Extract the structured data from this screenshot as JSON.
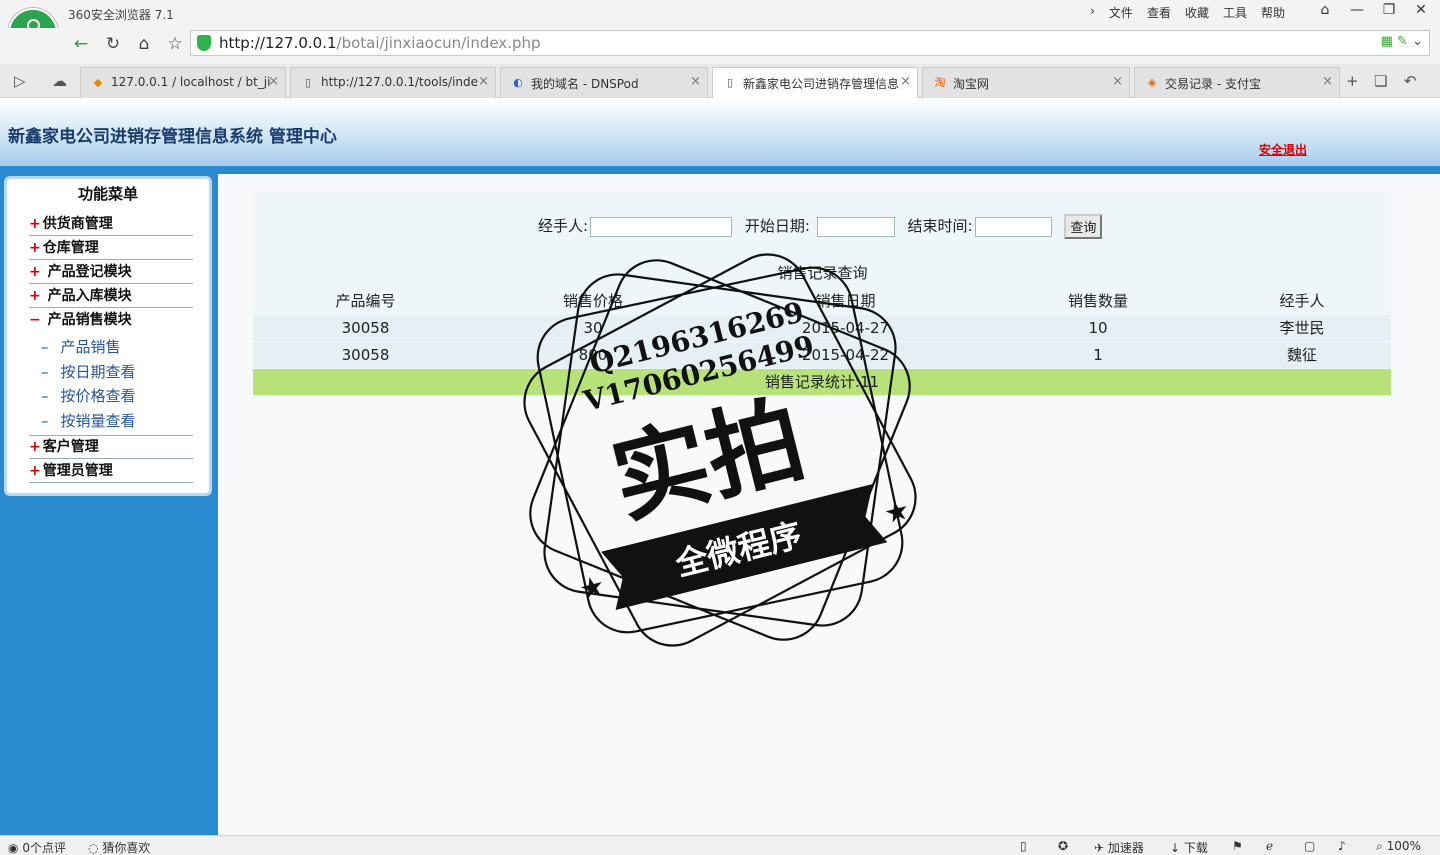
{
  "browser": {
    "app_title": "360安全浏览器 7.1",
    "menu": [
      "文件",
      "查看",
      "收藏",
      "工具",
      "帮助"
    ],
    "url_host": "http://127.0.0.1",
    "url_path": "/botai/jinxiaocun/index.php",
    "tabs": [
      {
        "label": "127.0.0.1 / localhost / bt_ji",
        "active": false
      },
      {
        "label": "http://127.0.0.1/tools/inde",
        "active": false
      },
      {
        "label": "我的域名 - DNSPod",
        "active": false
      },
      {
        "label": "新鑫家电公司进销存管理信息",
        "active": true
      },
      {
        "label": "淘宝网",
        "active": false
      },
      {
        "label": "交易记录 - 支付宝",
        "active": false
      }
    ],
    "zoom": "100%"
  },
  "header": {
    "title": "新鑫家电公司进销存管理信息系统 管理中心",
    "logout": "安全退出"
  },
  "sidebar": {
    "title": "功能菜单",
    "items": [
      {
        "sign": "+",
        "label": "供货商管理"
      },
      {
        "sign": "+",
        "label": "仓库管理"
      },
      {
        "sign": "+",
        "label": "产品登记模块"
      },
      {
        "sign": "+",
        "label": "产品入库模块"
      },
      {
        "sign": "−",
        "label": "产品销售模块"
      },
      {
        "sign": "+",
        "label": "客户管理"
      },
      {
        "sign": "+",
        "label": "管理员管理"
      }
    ],
    "subitems": [
      "产品销售",
      "按日期查看",
      "按价格查看",
      "按销量查看"
    ]
  },
  "query": {
    "handler_label": "经手人:",
    "start_label": "开始日期:",
    "end_label": "结束时间:",
    "button": "查询"
  },
  "table": {
    "caption": "销售记录查询",
    "headers": [
      "产品编号",
      "销售价格",
      "销售日期",
      "销售数量",
      "经手人"
    ],
    "rows": [
      [
        "30058",
        "30",
        "2015-04-27",
        "10",
        "李世民"
      ],
      [
        "30058",
        "800",
        "2015-04-22",
        "1",
        "魏征"
      ]
    ],
    "summary": "销售记录统计:11"
  },
  "watermark": {
    "line1": "Q2196316269",
    "line2": "V17060256499",
    "main": "实拍",
    "ribbon": "全微程序"
  },
  "statusbar": {
    "comments": "0个点评",
    "guess": "猜你喜欢",
    "accelerator": "加速器",
    "download": "下载"
  }
}
